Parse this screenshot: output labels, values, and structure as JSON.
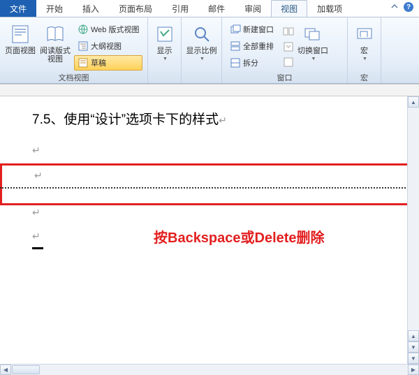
{
  "tabs": {
    "file": "文件",
    "home": "开始",
    "insert": "插入",
    "layout": "页面布局",
    "references": "引用",
    "mail": "邮件",
    "review": "审阅",
    "view": "视图",
    "addins": "加载项"
  },
  "ribbon": {
    "group_views": {
      "label": "文档视图",
      "page_view": "页面视图",
      "reading_view": "阅读版式视图",
      "web_view": "Web 版式视图",
      "outline_view": "大纲视图",
      "draft": "草稿"
    },
    "group_show": {
      "label": "显示",
      "btn": "显示"
    },
    "group_zoom": {
      "label": "",
      "btn": "显示比例"
    },
    "group_window": {
      "label": "窗口",
      "new_window": "新建窗口",
      "arrange_all": "全部重排",
      "split": "拆分",
      "switch": "切换窗口"
    },
    "group_macro": {
      "label": "宏",
      "btn": "宏"
    }
  },
  "document": {
    "heading": "7.5、使用“设计”选项卡下的样式",
    "annotation": "按Backspace或Delete删除"
  }
}
